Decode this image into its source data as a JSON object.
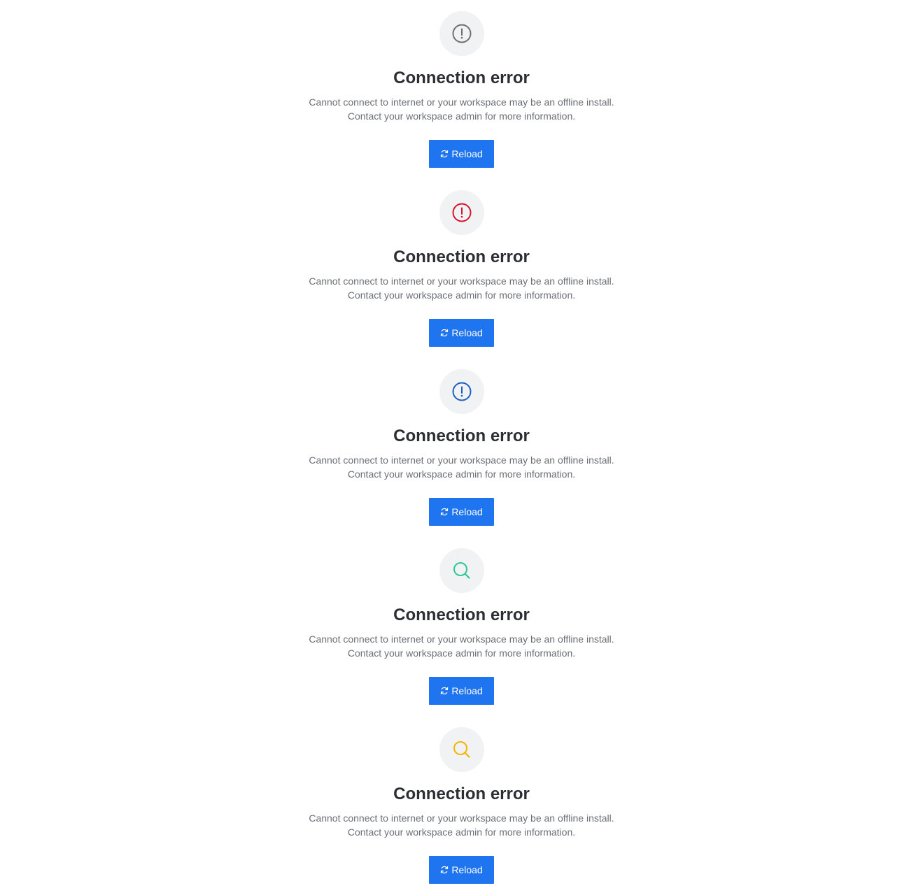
{
  "states": [
    {
      "icon": "exclamation-circle-icon",
      "icon_color": "#6b6f76",
      "title": "Connection error",
      "description_line1": "Cannot connect to internet or your workspace may be an offline install.",
      "description_line2": "Contact your workspace admin for more information.",
      "button_label": "Reload"
    },
    {
      "icon": "exclamation-circle-icon",
      "icon_color": "#d9132c",
      "title": "Connection error",
      "description_line1": "Cannot connect to internet or your workspace may be an offline install.",
      "description_line2": "Contact your workspace admin for more information.",
      "button_label": "Reload"
    },
    {
      "icon": "exclamation-circle-icon",
      "icon_color": "#1f5fbf",
      "title": "Connection error",
      "description_line1": "Cannot connect to internet or your workspace may be an offline install.",
      "description_line2": "Contact your workspace admin for more information.",
      "button_label": "Reload"
    },
    {
      "icon": "search-icon",
      "icon_color": "#2fc79a",
      "title": "Connection error",
      "description_line1": "Cannot connect to internet or your workspace may be an offline install.",
      "description_line2": "Contact your workspace admin for more information.",
      "button_label": "Reload"
    },
    {
      "icon": "search-icon",
      "icon_color": "#f4b400",
      "title": "Connection error",
      "description_line1": "Cannot connect to internet or your workspace may be an offline install.",
      "description_line2": "Contact your workspace admin for more information.",
      "button_label": "Reload"
    }
  ],
  "colors": {
    "button_bg": "#1f74f0",
    "icon_circle_bg": "#f1f2f4",
    "title": "#2b2e33",
    "description": "#6b6f76"
  }
}
